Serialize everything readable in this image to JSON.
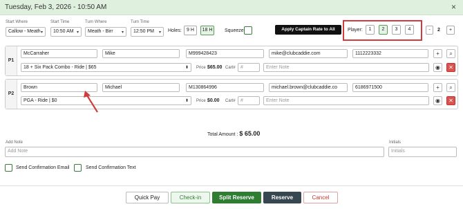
{
  "header": {
    "title": "Tuesday, Feb 3, 2026 - 10:50 AM",
    "close": "×"
  },
  "filters": {
    "start_where_label": "Start Where",
    "start_where": "Callow - Meath",
    "start_time_label": "Start Time",
    "start_time": "10:50 AM",
    "turn_where_label": "Turn Where",
    "turn_where": "Meath - Birr",
    "turn_time_label": "Turn Time",
    "turn_time": "12:50 PM",
    "holes_label": "Holes:",
    "holes": [
      "9 H",
      "18 H"
    ],
    "squeeze_label": "Squeeze",
    "apply_captain": "Apply Captain Rate to All",
    "player_label": "Player:",
    "player_counts": [
      "1",
      "2",
      "3",
      "4"
    ],
    "qty_minus": "-",
    "qty_value": "2",
    "qty_plus": "+"
  },
  "players": [
    {
      "label": "P1",
      "last": "McCarraher",
      "first": "Mike",
      "member": "M999428423",
      "email": "mike@clubcaddie.com",
      "phone": "1112223332",
      "rate": "18 + Six Pack Combo - Ride | $65",
      "price_label": "Price :",
      "price": "$65.00",
      "cart_label": "Cart#",
      "cart_placeholder": "#",
      "note_placeholder": "Enter Note"
    },
    {
      "label": "P2",
      "last": "Brown",
      "first": "Michael",
      "member": "M130864996",
      "email": "michael.brown@clubcaddie.co",
      "phone": "6186971500",
      "rate": "PGA - Ride | $0",
      "price_label": "Price :",
      "price": "$0.00",
      "cart_label": "Cart#",
      "cart_placeholder": "#",
      "note_placeholder": "Enter Note"
    }
  ],
  "icons": {
    "add": "+",
    "search": "⌕",
    "view": "◉",
    "remove": "✕",
    "caret": "⬍"
  },
  "total": {
    "label": "Total Amount :",
    "value": "$ 65.00"
  },
  "note": {
    "label": "Add Note",
    "placeholder": "Add Note",
    "initials_label": "Initials",
    "initials_placeholder": "Initials"
  },
  "confirm": {
    "email": "Send Confirmation Email",
    "text": "Send Confirmation Text"
  },
  "footer": {
    "quick_pay": "Quick Pay",
    "check_in": "Check-in",
    "split": "Split Reserve",
    "reserve": "Reserve",
    "cancel": "Cancel"
  },
  "colors": {
    "header_bg": "#dff0df",
    "green": "#2e7d32",
    "dark": "#37474f",
    "red": "#d9534f",
    "highlight": "#d23b3b"
  }
}
